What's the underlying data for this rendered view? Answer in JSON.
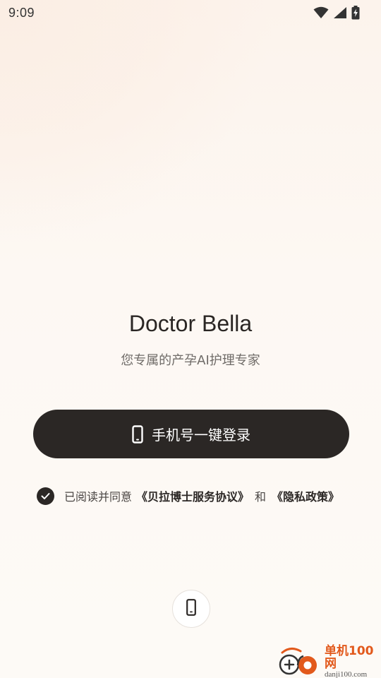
{
  "status_bar": {
    "time": "9:09",
    "icons": [
      "wifi-icon",
      "signal-icon",
      "battery-charging-icon"
    ]
  },
  "app": {
    "title": "Doctor Bella",
    "subtitle": "您专属的产孕AI护理专家"
  },
  "login_button": {
    "icon": "phone-icon",
    "label": "手机号一键登录"
  },
  "agreement": {
    "checked": true,
    "prefix": "已阅读并同意",
    "service_link": "《贝拉博士服务协议》",
    "conjunction": "和",
    "privacy_link": "《隐私政策》"
  },
  "alt_login": {
    "icon": "phone-icon"
  },
  "watermark": {
    "name": "单机100网",
    "url": "danji100.com"
  },
  "colors": {
    "primary": "#2b2725",
    "background": "#fdfaf6",
    "watermark_accent": "#e2591c"
  }
}
